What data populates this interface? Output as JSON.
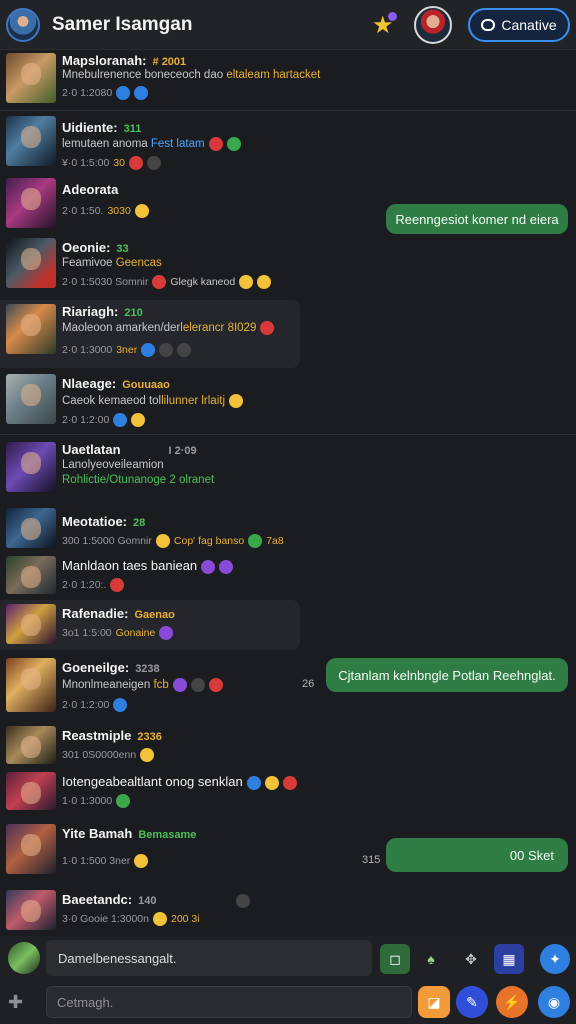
{
  "header": {
    "title": "Samer Isamgan",
    "action_label": "Canative"
  },
  "messages": [
    {
      "name": "Mapsloranah:",
      "tag": "# 2001",
      "line": "Mnebulrenence boneceoch dao",
      "line_hl": "eltaleam hartacket",
      "meta": "2·0 1:2080"
    },
    {
      "name": "Uidiente:",
      "tag": "311",
      "line": "lemutaen anoma",
      "line_hl": "Fest latam",
      "meta": "¥·0 1:5:00",
      "meta_hl": "30"
    },
    {
      "name": "Adeorata",
      "tag": "",
      "line": "",
      "line_hl": "",
      "meta": "2·0 1:50.",
      "meta_hl": "3030"
    },
    {
      "name": "Oeonie:",
      "tag": "33",
      "line": "Feamivoe",
      "line_hl": "Geencas",
      "meta": "2·0 1:5030 Somnir",
      "meta_hl": "Glegk kaneod"
    },
    {
      "name": "Riariagh:",
      "tag": "210",
      "line": "Maoleoon amarken/der",
      "line_hl": "lelerancr 8I029",
      "meta": "2·0 1:3000",
      "meta_hl": "3ner"
    },
    {
      "name": "Nlaeage:",
      "tag": "Gouuaao",
      "line": "Caeok kemaeod tol",
      "line_hl": "lilunner lrlaitj",
      "meta": "2·0 1:2:00"
    },
    {
      "name": "Uaetlatan",
      "tag": "I 2·09",
      "line": "Lanolyeoveileamion",
      "line_hl": "Rohlictie/Otunanoge 2 olranet",
      "meta": ""
    },
    {
      "name": "Meotatioe:",
      "tag": "28",
      "line": "",
      "line_hl": "",
      "meta": "300 1:5000 Gomnir",
      "meta_hl": "Cop' fag banso",
      "meta_hl2": "7a8"
    },
    {
      "name": "Manldaon taes baniean",
      "tag": "",
      "line": "",
      "line_hl": "",
      "meta": "2·0 1:20:."
    },
    {
      "name": "Rafenadie:",
      "tag": "Gaenao",
      "line": "",
      "line_hl": "",
      "meta": "3o1 1:5:00",
      "meta_hl": "Gonaine"
    },
    {
      "name": "Goeneilge:",
      "tag": "3238",
      "line": "Mnonlmeaneigen",
      "line_hl": "fcb",
      "meta": "2·0 1:2:00",
      "side": "26"
    },
    {
      "name": "Reastmiple",
      "tag": "2336",
      "line": "",
      "line_hl": "",
      "meta": "301 0S0000enn"
    },
    {
      "name": "Iotengeabealtlant onog senklan",
      "tag": "",
      "line": "",
      "line_hl": "",
      "meta": "1·0 1:3000"
    },
    {
      "name": "Yite Bamah",
      "tag": "Bemasame",
      "line": "",
      "line_hl": "",
      "meta": "1·0 1:500 3ner",
      "side": "315"
    },
    {
      "name": "Baeetandc:",
      "tag": "140",
      "line": "",
      "line_hl": "",
      "meta": "3·0 Gooie 1:3000n",
      "meta_hl": "200 3i"
    }
  ],
  "outgoing": [
    "Reenngesiot komer nd eiera",
    "Cjtanlam kelnbngle Potlan Reehnglat.",
    "00 Sket"
  ],
  "composer": {
    "top_text": "Damelbenessangalt.",
    "placeholder": "Cetmagh."
  },
  "icons": {
    "accent": "#3a8ff2",
    "bubble": "#2f7d45"
  }
}
